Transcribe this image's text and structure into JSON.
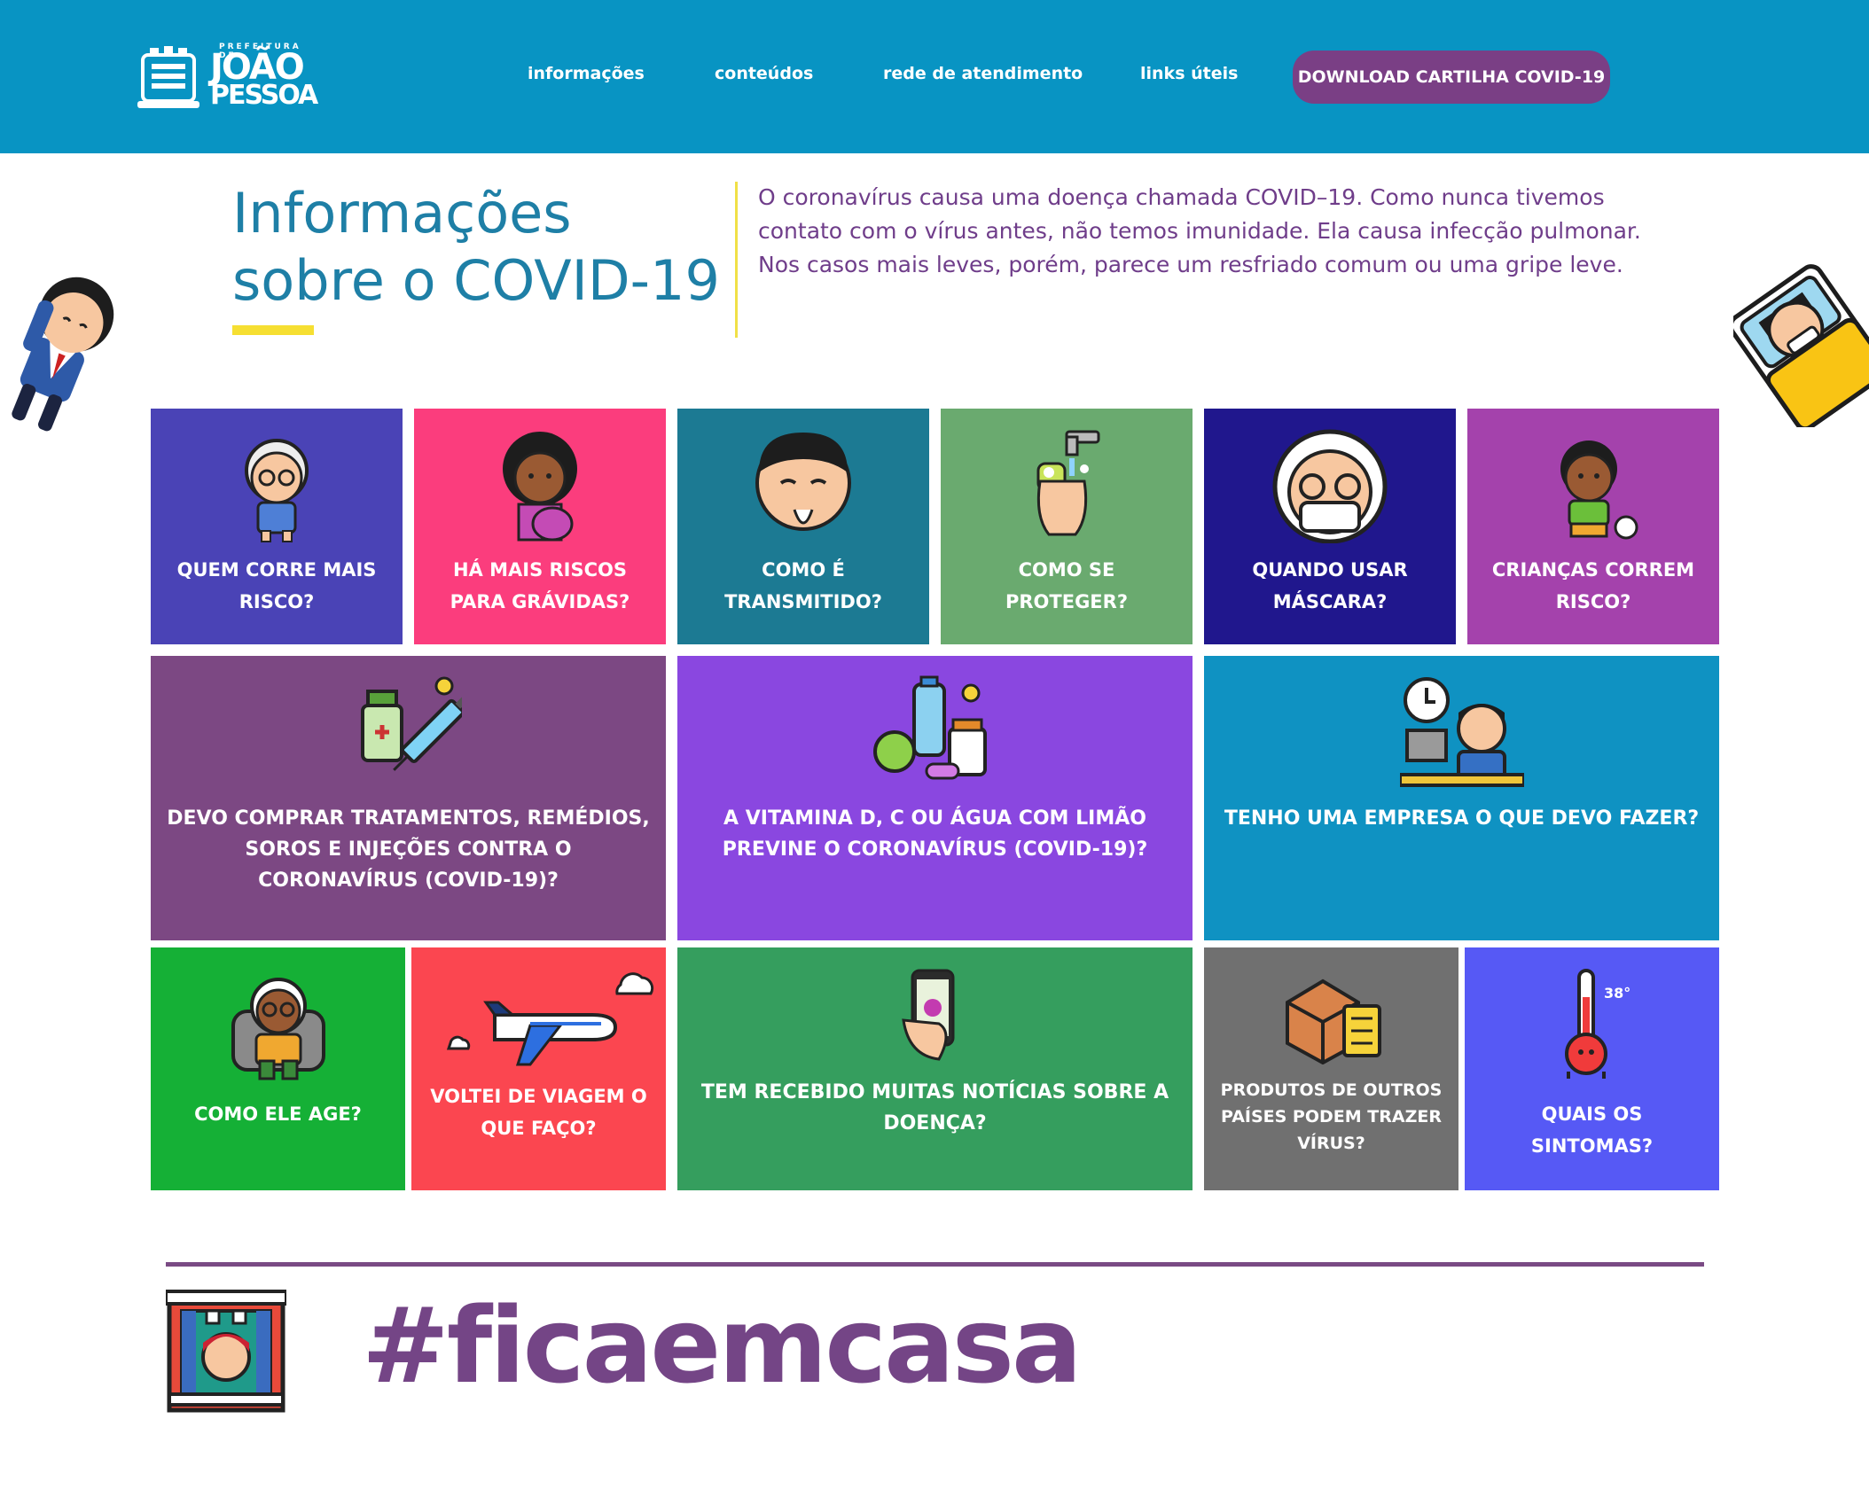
{
  "header": {
    "logo": {
      "line_small": "PREFEITURA DE",
      "line1": "JOÃO",
      "line2": "PESSOA"
    },
    "nav": [
      {
        "label": "informações"
      },
      {
        "label": "conteúdos"
      },
      {
        "label": "rede de atendimento"
      },
      {
        "label": "links úteis"
      }
    ],
    "cta_label": "DOWNLOAD CARTILHA COVID-19",
    "color": "#0894c3"
  },
  "intro": {
    "title_line1": "Informações",
    "title_line2": "sobre o COVID-19",
    "text": "O coronavírus causa uma doença chamada COVID–19. Como nunca tivemos contato com o vírus antes, não temos imunidade. Ela causa infecção pulmonar. Nos casos mais leves, porém, parece um resfriado comum ou uma gripe leve."
  },
  "tiles": [
    {
      "label": "QUEM CORRE MAIS RISCO?",
      "color": "#4a43b6",
      "icon": "elderly-woman-icon"
    },
    {
      "label": "HÁ MAIS RISCOS PARA GRÁVIDAS?",
      "color": "#fb3d7d",
      "icon": "pregnant-woman-icon"
    },
    {
      "label": "COMO É TRANSMITIDO?",
      "color": "#1c7a93",
      "icon": "sneezing-man-icon"
    },
    {
      "label": "COMO SE PROTEGER?",
      "color": "#6aaa6f",
      "icon": "hand-washing-icon"
    },
    {
      "label": "QUANDO USAR MÁSCARA?",
      "color": "#20178d",
      "icon": "masked-elder-icon"
    },
    {
      "label": "CRIANÇAS CORREM RISCO?",
      "color": "#a442ac",
      "icon": "child-ball-icon"
    },
    {
      "label": "DEVO COMPRAR TRATAMENTOS, REMÉDIOS, SOROS E INJEÇÕES CONTRA O CORONAVÍRUS (COVID-19)?",
      "color": "#7c4883",
      "icon": "syringe-medicine-icon"
    },
    {
      "label": "A VITAMINA D, C OU ÁGUA COM LIMÃO PREVINE O CORONAVÍRUS (COVID-19)?",
      "color": "#8a47e0",
      "icon": "vitamins-lemon-icon"
    },
    {
      "label": "TENHO UMA EMPRESA O QUE DEVO FAZER?",
      "color": "#0f92c2",
      "icon": "office-worker-icon"
    },
    {
      "label": "COMO ELE AGE?",
      "color": "#15b036",
      "icon": "elder-armchair-icon"
    },
    {
      "label": "VOLTEI DE VIAGEM O QUE FAÇO?",
      "color": "#fb4650",
      "icon": "airplane-icon"
    },
    {
      "label": "TEM RECEBIDO MUITAS NOTÍCIAS SOBRE A DOENÇA?",
      "color": "#359e5e",
      "icon": "phone-virus-icon"
    },
    {
      "label": "PRODUTOS DE OUTROS PAÍSES PODEM TRAZER VÍRUS?",
      "color": "#707070",
      "icon": "package-checklist-icon"
    },
    {
      "label": "QUAIS OS SINTOMAS?",
      "color": "#5659f5",
      "icon": "thermometer-icon",
      "thermo_value": "38°"
    }
  ],
  "footer": {
    "hashtag": "#ficaemcasa",
    "color": "#744586"
  }
}
